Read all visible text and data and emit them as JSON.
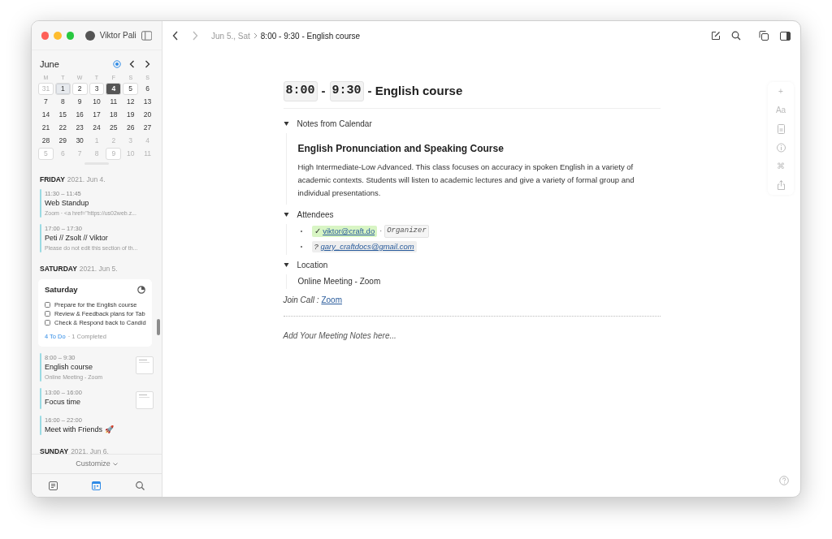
{
  "sidebar": {
    "user": "Viktor Pali",
    "calendar": {
      "month": "June",
      "weekdays": [
        "M",
        "T",
        "W",
        "T",
        "F",
        "S",
        "S"
      ],
      "days": [
        {
          "text": "31",
          "muted": true,
          "outlined": true,
          "today": false,
          "selected": false
        },
        {
          "text": "1",
          "muted": false,
          "outlined": true,
          "today": true,
          "selected": false
        },
        {
          "text": "2",
          "muted": false,
          "outlined": true,
          "today": false,
          "selected": false
        },
        {
          "text": "3",
          "muted": false,
          "outlined": true,
          "today": false,
          "selected": false
        },
        {
          "text": "4",
          "muted": false,
          "outlined": true,
          "today": false,
          "selected": true
        },
        {
          "text": "5",
          "muted": false,
          "outlined": true,
          "today": false,
          "selected": false
        },
        {
          "text": "6",
          "muted": false,
          "outlined": false,
          "today": false,
          "selected": false
        },
        {
          "text": "7",
          "muted": false,
          "outlined": false,
          "today": false,
          "selected": false
        },
        {
          "text": "8",
          "muted": false,
          "outlined": false,
          "today": false,
          "selected": false
        },
        {
          "text": "9",
          "muted": false,
          "outlined": false,
          "today": false,
          "selected": false
        },
        {
          "text": "10",
          "muted": false,
          "outlined": false,
          "today": false,
          "selected": false
        },
        {
          "text": "11",
          "muted": false,
          "outlined": false,
          "today": false,
          "selected": false
        },
        {
          "text": "12",
          "muted": false,
          "outlined": false,
          "today": false,
          "selected": false
        },
        {
          "text": "13",
          "muted": false,
          "outlined": false,
          "today": false,
          "selected": false
        },
        {
          "text": "14",
          "muted": false,
          "outlined": false,
          "today": false,
          "selected": false
        },
        {
          "text": "15",
          "muted": false,
          "outlined": false,
          "today": false,
          "selected": false
        },
        {
          "text": "16",
          "muted": false,
          "outlined": false,
          "today": false,
          "selected": false
        },
        {
          "text": "17",
          "muted": false,
          "outlined": false,
          "today": false,
          "selected": false
        },
        {
          "text": "18",
          "muted": false,
          "outlined": false,
          "today": false,
          "selected": false
        },
        {
          "text": "19",
          "muted": false,
          "outlined": false,
          "today": false,
          "selected": false
        },
        {
          "text": "20",
          "muted": false,
          "outlined": false,
          "today": false,
          "selected": false
        },
        {
          "text": "21",
          "muted": false,
          "outlined": false,
          "today": false,
          "selected": false
        },
        {
          "text": "22",
          "muted": false,
          "outlined": false,
          "today": false,
          "selected": false
        },
        {
          "text": "23",
          "muted": false,
          "outlined": false,
          "today": false,
          "selected": false
        },
        {
          "text": "24",
          "muted": false,
          "outlined": false,
          "today": false,
          "selected": false
        },
        {
          "text": "25",
          "muted": false,
          "outlined": false,
          "today": false,
          "selected": false
        },
        {
          "text": "26",
          "muted": false,
          "outlined": false,
          "today": false,
          "selected": false
        },
        {
          "text": "27",
          "muted": false,
          "outlined": false,
          "today": false,
          "selected": false
        },
        {
          "text": "28",
          "muted": false,
          "outlined": false,
          "today": false,
          "selected": false
        },
        {
          "text": "29",
          "muted": false,
          "outlined": false,
          "today": false,
          "selected": false
        },
        {
          "text": "30",
          "muted": false,
          "outlined": false,
          "today": false,
          "selected": false
        },
        {
          "text": "1",
          "muted": true,
          "outlined": false,
          "today": false,
          "selected": false
        },
        {
          "text": "2",
          "muted": true,
          "outlined": false,
          "today": false,
          "selected": false
        },
        {
          "text": "3",
          "muted": true,
          "outlined": false,
          "today": false,
          "selected": false
        },
        {
          "text": "4",
          "muted": true,
          "outlined": false,
          "today": false,
          "selected": false
        },
        {
          "text": "5",
          "muted": true,
          "outlined": true,
          "today": false,
          "selected": false
        },
        {
          "text": "6",
          "muted": true,
          "outlined": false,
          "today": false,
          "selected": false
        },
        {
          "text": "7",
          "muted": true,
          "outlined": false,
          "today": false,
          "selected": false
        },
        {
          "text": "8",
          "muted": true,
          "outlined": false,
          "today": false,
          "selected": false
        },
        {
          "text": "9",
          "muted": true,
          "outlined": true,
          "today": false,
          "selected": false
        },
        {
          "text": "10",
          "muted": true,
          "outlined": false,
          "today": false,
          "selected": false
        },
        {
          "text": "11",
          "muted": true,
          "outlined": false,
          "today": false,
          "selected": false
        }
      ]
    },
    "agenda": [
      {
        "kind": "day",
        "weekday": "FRIDAY",
        "date": "2021. Jun 4."
      },
      {
        "kind": "event",
        "time": "11:30 – 11:45",
        "title": "Web Standup",
        "subtitle": "Zoom · <a href=\"https://us02web.z...",
        "thumbnail": false
      },
      {
        "kind": "event",
        "time": "17:00 – 17:30",
        "title": "Peti // Zsolt // Viktor",
        "subtitle": "Please do not edit this section of th...",
        "thumbnail": false
      },
      {
        "kind": "day",
        "weekday": "SATURDAY",
        "date": "2021. Jun 5."
      },
      {
        "kind": "card",
        "title": "Saturday",
        "tasks": [
          {
            "text": "Prepare for the English course",
            "checked": false
          },
          {
            "text": "Review & Feedback plans for Tab",
            "checked": false
          },
          {
            "text": "Check & Respond back to Candid",
            "checked": false
          }
        ],
        "todo": "4 To Do",
        "completed": "· 1 Completed"
      },
      {
        "kind": "event",
        "time": "8:00 – 9:30",
        "title": "English course",
        "subtitle": "Online Meeting - Zoom",
        "thumbnail": true
      },
      {
        "kind": "event",
        "time": "13:00 – 16:00",
        "title": "Focus time",
        "thumbnail": true
      },
      {
        "kind": "event",
        "time": "16:00 – 22:00",
        "title": "Meet with Friends 🚀",
        "thumbnail": false
      },
      {
        "kind": "day",
        "weekday": "SUNDAY",
        "date": "2021. Jun 6."
      }
    ],
    "customize": "Customize",
    "bottom_tabs": [
      {
        "kind": "notes",
        "selected": false
      },
      {
        "kind": "calendar",
        "selected": true
      },
      {
        "kind": "search",
        "selected": false
      }
    ]
  },
  "breadcrumb": {
    "parent": "Jun 5., Sat",
    "current": "8:00 - 9:30 - English course"
  },
  "document": {
    "title_parts": [
      {
        "kind": "code",
        "text": "8:00"
      },
      {
        "kind": "text",
        "text": "-"
      },
      {
        "kind": "code",
        "text": "9:30"
      },
      {
        "kind": "text",
        "text": "- English course"
      }
    ],
    "sections": [
      {
        "kind": "notes",
        "label": "Notes from Calendar",
        "expanded": true,
        "heading": "English Pronunciation and Speaking Course",
        "body": "High Intermediate-Low Advanced. This class focuses on accuracy in spoken English in a variety of academic contexts. Students will listen to academic lectures and give a variety of formal group and individual presentations."
      },
      {
        "kind": "attendees",
        "label": "Attendees",
        "expanded": true,
        "attendees": [
          {
            "mark": "✓",
            "email": "viktor@craft.do",
            "accepted": true,
            "separator": "·",
            "role": "Organizer"
          },
          {
            "mark": "?",
            "email": "gary_craftdocs@gmail.com",
            "accepted": false
          }
        ]
      },
      {
        "kind": "location",
        "label": "Location",
        "expanded": true,
        "value": "Online Meeting - Zoom"
      }
    ],
    "join_label": "Join Call :",
    "join_link": "Zoom",
    "placeholder": "Add Your Meeting Notes here..."
  },
  "side_toolbar": [
    {
      "kind": "glyph",
      "text": "+"
    },
    {
      "kind": "glyph",
      "text": "Aa"
    },
    {
      "kind": "doc"
    },
    {
      "kind": "info"
    },
    {
      "kind": "glyph",
      "text": "⌘"
    },
    {
      "kind": "share"
    }
  ]
}
